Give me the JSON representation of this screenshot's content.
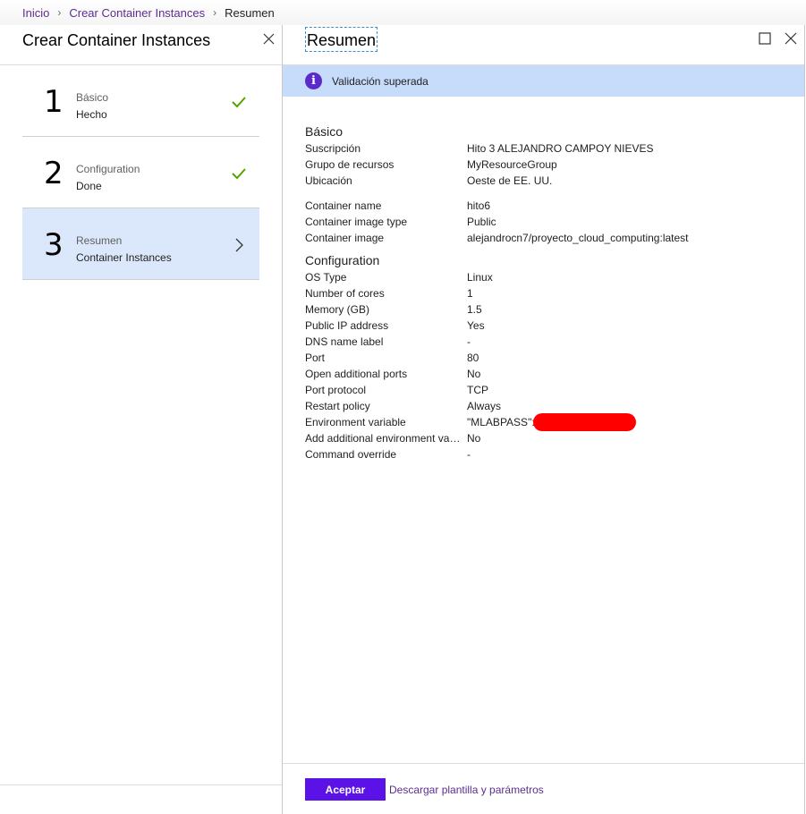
{
  "breadcrumb": {
    "items": [
      "Inicio",
      "Crear Container Instances",
      "Resumen"
    ]
  },
  "left_blade": {
    "title": "Crear Container Instances",
    "steps": [
      {
        "number": "1",
        "title": "Básico",
        "subtitle": "Hecho",
        "status_icon": "check-icon"
      },
      {
        "number": "2",
        "title": "Configuration",
        "subtitle": "Done",
        "status_icon": "check-icon"
      },
      {
        "number": "3",
        "title": "Resumen",
        "subtitle": "Container Instances",
        "status_icon": "chevron-right-icon"
      }
    ]
  },
  "right_blade": {
    "title": "Resumen",
    "banner": {
      "text": "Validación superada",
      "icon": "info-icon"
    },
    "basic": {
      "title": "Básico",
      "group1": [
        {
          "k": "Suscripción",
          "v": "Hito 3 ALEJANDRO CAMPOY NIEVES"
        },
        {
          "k": "Grupo de recursos",
          "v": "MyResourceGroup"
        },
        {
          "k": "Ubicación",
          "v": "Oeste de EE. UU."
        }
      ],
      "group2": [
        {
          "k": "Container name",
          "v": "hito6"
        },
        {
          "k": "Container image type",
          "v": "Public"
        },
        {
          "k": "Container image",
          "v": "alejandrocn7/proyecto_cloud_computing:latest"
        }
      ]
    },
    "configuration": {
      "title": "Configuration",
      "rows": [
        {
          "k": "OS Type",
          "v": "Linux"
        },
        {
          "k": "Number of cores",
          "v": "1"
        },
        {
          "k": "Memory (GB)",
          "v": "1.5"
        },
        {
          "k": "Public IP address",
          "v": "Yes"
        },
        {
          "k": "DNS name label",
          "v": "-"
        },
        {
          "k": "Port",
          "v": "80"
        },
        {
          "k": "Open additional ports",
          "v": "No"
        },
        {
          "k": "Port protocol",
          "v": "TCP"
        },
        {
          "k": "Restart policy",
          "v": "Always"
        },
        {
          "k": "Environment variable",
          "v": "\"MLABPASS\":"
        },
        {
          "k": "Add additional environment variables",
          "v": "No"
        },
        {
          "k": "Command override",
          "v": "-"
        }
      ]
    },
    "footer": {
      "accept_label": "Aceptar",
      "download_label": "Descargar plantilla y parámetros"
    }
  },
  "colors": {
    "accent": "#5b12e6",
    "link": "#5c2d91",
    "banner_bg": "#c7dbfa",
    "active_step_bg": "#dbe8fb",
    "check": "#57a300",
    "redaction": "#ff0000"
  }
}
